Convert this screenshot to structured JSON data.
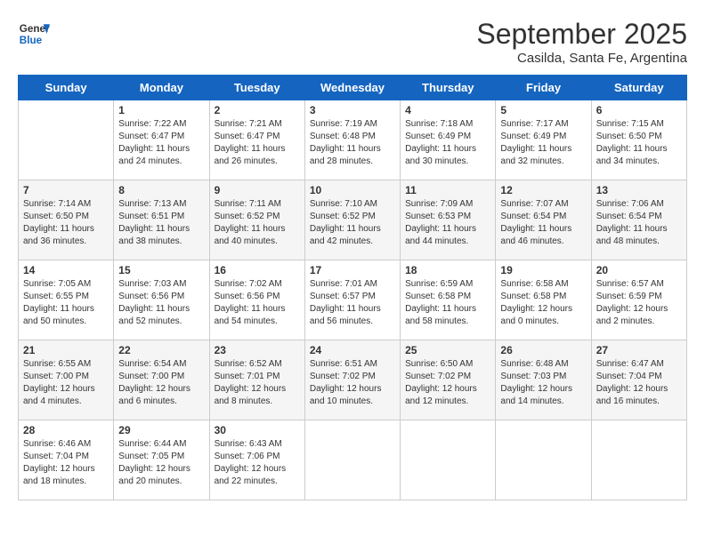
{
  "logo": {
    "line1": "General",
    "line2": "Blue"
  },
  "title": "September 2025",
  "subtitle": "Casilda, Santa Fe, Argentina",
  "days_of_week": [
    "Sunday",
    "Monday",
    "Tuesday",
    "Wednesday",
    "Thursday",
    "Friday",
    "Saturday"
  ],
  "weeks": [
    [
      {
        "day": "",
        "sunrise": "",
        "sunset": "",
        "daylight": ""
      },
      {
        "day": "1",
        "sunrise": "Sunrise: 7:22 AM",
        "sunset": "Sunset: 6:47 PM",
        "daylight": "Daylight: 11 hours and 24 minutes."
      },
      {
        "day": "2",
        "sunrise": "Sunrise: 7:21 AM",
        "sunset": "Sunset: 6:47 PM",
        "daylight": "Daylight: 11 hours and 26 minutes."
      },
      {
        "day": "3",
        "sunrise": "Sunrise: 7:19 AM",
        "sunset": "Sunset: 6:48 PM",
        "daylight": "Daylight: 11 hours and 28 minutes."
      },
      {
        "day": "4",
        "sunrise": "Sunrise: 7:18 AM",
        "sunset": "Sunset: 6:49 PM",
        "daylight": "Daylight: 11 hours and 30 minutes."
      },
      {
        "day": "5",
        "sunrise": "Sunrise: 7:17 AM",
        "sunset": "Sunset: 6:49 PM",
        "daylight": "Daylight: 11 hours and 32 minutes."
      },
      {
        "day": "6",
        "sunrise": "Sunrise: 7:15 AM",
        "sunset": "Sunset: 6:50 PM",
        "daylight": "Daylight: 11 hours and 34 minutes."
      }
    ],
    [
      {
        "day": "7",
        "sunrise": "Sunrise: 7:14 AM",
        "sunset": "Sunset: 6:50 PM",
        "daylight": "Daylight: 11 hours and 36 minutes."
      },
      {
        "day": "8",
        "sunrise": "Sunrise: 7:13 AM",
        "sunset": "Sunset: 6:51 PM",
        "daylight": "Daylight: 11 hours and 38 minutes."
      },
      {
        "day": "9",
        "sunrise": "Sunrise: 7:11 AM",
        "sunset": "Sunset: 6:52 PM",
        "daylight": "Daylight: 11 hours and 40 minutes."
      },
      {
        "day": "10",
        "sunrise": "Sunrise: 7:10 AM",
        "sunset": "Sunset: 6:52 PM",
        "daylight": "Daylight: 11 hours and 42 minutes."
      },
      {
        "day": "11",
        "sunrise": "Sunrise: 7:09 AM",
        "sunset": "Sunset: 6:53 PM",
        "daylight": "Daylight: 11 hours and 44 minutes."
      },
      {
        "day": "12",
        "sunrise": "Sunrise: 7:07 AM",
        "sunset": "Sunset: 6:54 PM",
        "daylight": "Daylight: 11 hours and 46 minutes."
      },
      {
        "day": "13",
        "sunrise": "Sunrise: 7:06 AM",
        "sunset": "Sunset: 6:54 PM",
        "daylight": "Daylight: 11 hours and 48 minutes."
      }
    ],
    [
      {
        "day": "14",
        "sunrise": "Sunrise: 7:05 AM",
        "sunset": "Sunset: 6:55 PM",
        "daylight": "Daylight: 11 hours and 50 minutes."
      },
      {
        "day": "15",
        "sunrise": "Sunrise: 7:03 AM",
        "sunset": "Sunset: 6:56 PM",
        "daylight": "Daylight: 11 hours and 52 minutes."
      },
      {
        "day": "16",
        "sunrise": "Sunrise: 7:02 AM",
        "sunset": "Sunset: 6:56 PM",
        "daylight": "Daylight: 11 hours and 54 minutes."
      },
      {
        "day": "17",
        "sunrise": "Sunrise: 7:01 AM",
        "sunset": "Sunset: 6:57 PM",
        "daylight": "Daylight: 11 hours and 56 minutes."
      },
      {
        "day": "18",
        "sunrise": "Sunrise: 6:59 AM",
        "sunset": "Sunset: 6:58 PM",
        "daylight": "Daylight: 11 hours and 58 minutes."
      },
      {
        "day": "19",
        "sunrise": "Sunrise: 6:58 AM",
        "sunset": "Sunset: 6:58 PM",
        "daylight": "Daylight: 12 hours and 0 minutes."
      },
      {
        "day": "20",
        "sunrise": "Sunrise: 6:57 AM",
        "sunset": "Sunset: 6:59 PM",
        "daylight": "Daylight: 12 hours and 2 minutes."
      }
    ],
    [
      {
        "day": "21",
        "sunrise": "Sunrise: 6:55 AM",
        "sunset": "Sunset: 7:00 PM",
        "daylight": "Daylight: 12 hours and 4 minutes."
      },
      {
        "day": "22",
        "sunrise": "Sunrise: 6:54 AM",
        "sunset": "Sunset: 7:00 PM",
        "daylight": "Daylight: 12 hours and 6 minutes."
      },
      {
        "day": "23",
        "sunrise": "Sunrise: 6:52 AM",
        "sunset": "Sunset: 7:01 PM",
        "daylight": "Daylight: 12 hours and 8 minutes."
      },
      {
        "day": "24",
        "sunrise": "Sunrise: 6:51 AM",
        "sunset": "Sunset: 7:02 PM",
        "daylight": "Daylight: 12 hours and 10 minutes."
      },
      {
        "day": "25",
        "sunrise": "Sunrise: 6:50 AM",
        "sunset": "Sunset: 7:02 PM",
        "daylight": "Daylight: 12 hours and 12 minutes."
      },
      {
        "day": "26",
        "sunrise": "Sunrise: 6:48 AM",
        "sunset": "Sunset: 7:03 PM",
        "daylight": "Daylight: 12 hours and 14 minutes."
      },
      {
        "day": "27",
        "sunrise": "Sunrise: 6:47 AM",
        "sunset": "Sunset: 7:04 PM",
        "daylight": "Daylight: 12 hours and 16 minutes."
      }
    ],
    [
      {
        "day": "28",
        "sunrise": "Sunrise: 6:46 AM",
        "sunset": "Sunset: 7:04 PM",
        "daylight": "Daylight: 12 hours and 18 minutes."
      },
      {
        "day": "29",
        "sunrise": "Sunrise: 6:44 AM",
        "sunset": "Sunset: 7:05 PM",
        "daylight": "Daylight: 12 hours and 20 minutes."
      },
      {
        "day": "30",
        "sunrise": "Sunrise: 6:43 AM",
        "sunset": "Sunset: 7:06 PM",
        "daylight": "Daylight: 12 hours and 22 minutes."
      },
      {
        "day": "",
        "sunrise": "",
        "sunset": "",
        "daylight": ""
      },
      {
        "day": "",
        "sunrise": "",
        "sunset": "",
        "daylight": ""
      },
      {
        "day": "",
        "sunrise": "",
        "sunset": "",
        "daylight": ""
      },
      {
        "day": "",
        "sunrise": "",
        "sunset": "",
        "daylight": ""
      }
    ]
  ]
}
